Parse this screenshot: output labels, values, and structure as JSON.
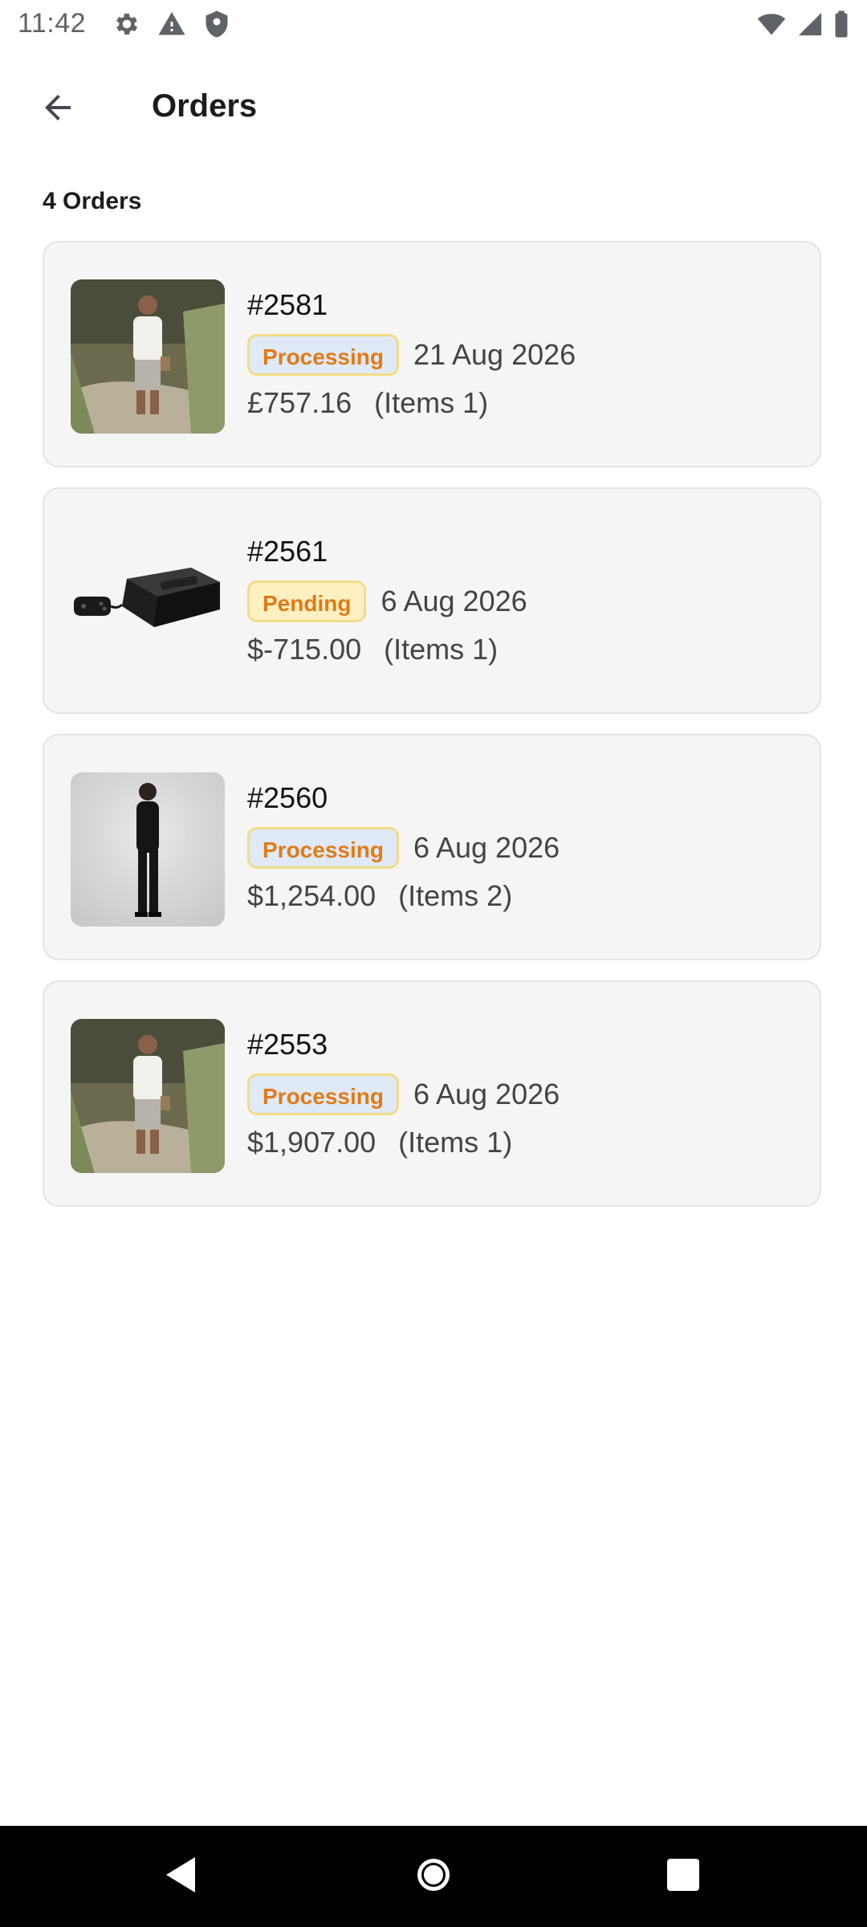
{
  "status_bar": {
    "time": "11:42",
    "left_icons": [
      "gear-icon",
      "warning-icon",
      "shield-icon"
    ],
    "right_icons": [
      "wifi-icon",
      "signal-icon",
      "battery-icon"
    ]
  },
  "header": {
    "title": "Orders",
    "back_icon": "arrow-left-icon"
  },
  "orders_count_label": "4 Orders",
  "orders": [
    {
      "number": "#2581",
      "status": "Processing",
      "date": "21 Aug 2026",
      "price": "£757.16",
      "items": "(Items 1)",
      "thumbnail": "man-white-shirt-photo"
    },
    {
      "number": "#2561",
      "status": "Pending",
      "date": "6 Aug 2026",
      "price": "$-715.00",
      "items": "(Items 1)",
      "thumbnail": "game-console-photo"
    },
    {
      "number": "#2560",
      "status": "Processing",
      "date": "6 Aug 2026",
      "price": "$1,254.00",
      "items": "(Items 2)",
      "thumbnail": "woman-black-outfit-photo"
    },
    {
      "number": "#2553",
      "status": "Processing",
      "date": "6 Aug 2026",
      "price": "$1,907.00",
      "items": "(Items 1)",
      "thumbnail": "man-white-shirt-photo"
    }
  ],
  "colors": {
    "status_text": "#e07b16",
    "processing_bg": "#dfe9f7",
    "pending_bg": "#fff0c2",
    "badge_border": "#f3dc86",
    "card_bg": "#f5f5f5"
  },
  "nav_bar": {
    "icons": [
      "back-triangle-icon",
      "home-circle-icon",
      "recents-square-icon"
    ]
  }
}
